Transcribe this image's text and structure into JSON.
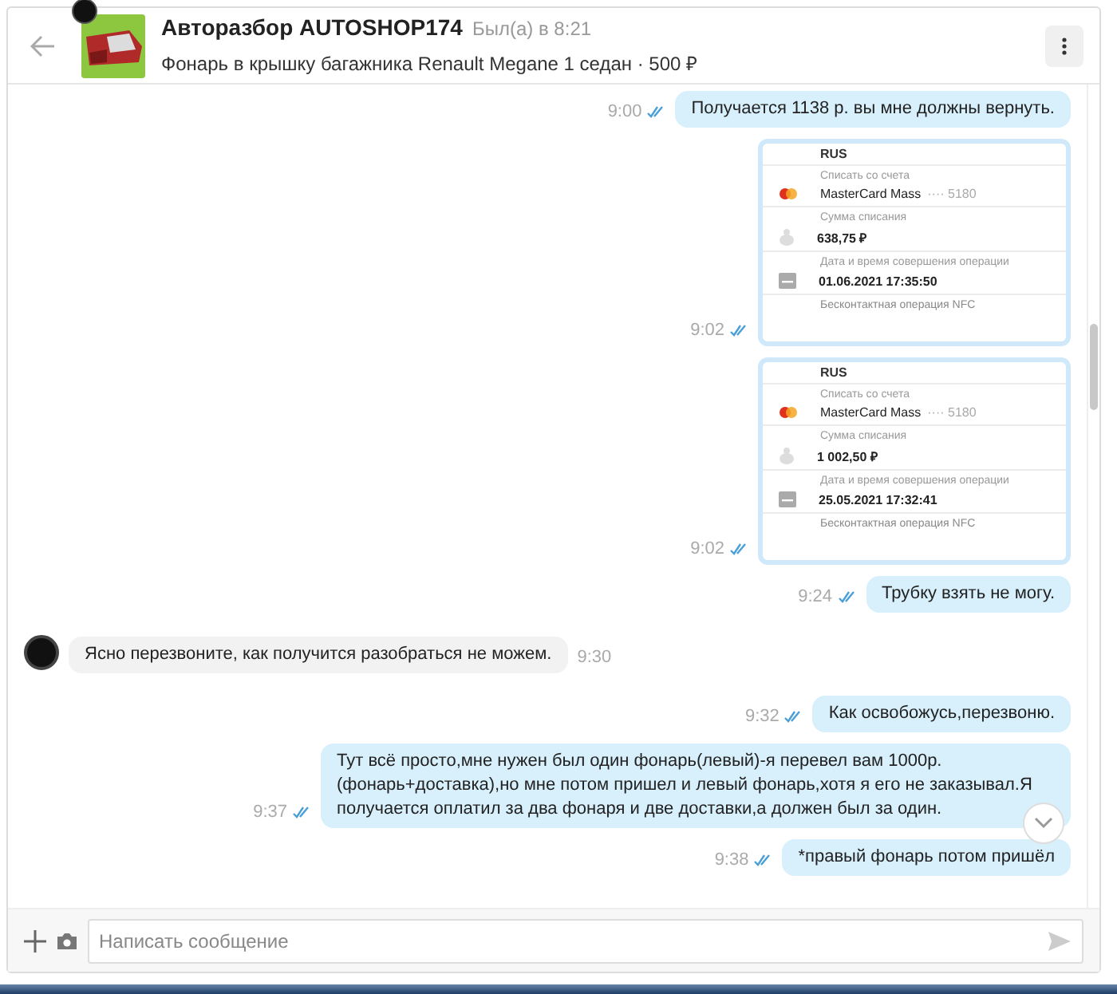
{
  "header": {
    "title": "Авторазбор AUTOSHOP174",
    "status": "Был(а) в 8:21",
    "subtitle": "Фонарь в крышку багажника Renault Megane 1 седан · 500 ₽"
  },
  "messages": [
    {
      "kind": "text",
      "outgoing": true,
      "time": "9:00",
      "read": true,
      "text": "Получается 1138 р. вы мне должны вернуть."
    },
    {
      "kind": "receipt",
      "outgoing": true,
      "time": "9:02",
      "read": true,
      "top": "RUS",
      "rows": [
        {
          "label": "Списать со счета",
          "value": "MasterCard Mass",
          "suffix": "···· 5180"
        },
        {
          "label": "Сумма списания",
          "value": "638,75 ₽"
        },
        {
          "label": "Дата и время совершения операции",
          "value": "01.06.2021 17:35:50"
        }
      ],
      "bottom": "Бесконтактная операция NFC"
    },
    {
      "kind": "receipt",
      "outgoing": true,
      "time": "9:02",
      "read": true,
      "top": "RUS",
      "rows": [
        {
          "label": "Списать со счета",
          "value": "MasterCard Mass",
          "suffix": "···· 5180"
        },
        {
          "label": "Сумма списания",
          "value": "1 002,50 ₽"
        },
        {
          "label": "Дата и время совершения операции",
          "value": "25.05.2021 17:32:41"
        }
      ],
      "bottom": "Бесконтактная операция NFC"
    },
    {
      "kind": "text",
      "outgoing": true,
      "time": "9:24",
      "read": true,
      "text": "Трубку взять не могу."
    },
    {
      "kind": "text",
      "outgoing": false,
      "time": "9:30",
      "text": "Ясно перезвоните, как получится разобраться не можем."
    },
    {
      "kind": "text",
      "outgoing": true,
      "time": "9:32",
      "read": true,
      "text": "Как освобожусь,перезвоню."
    },
    {
      "kind": "text",
      "outgoing": true,
      "time": "9:37",
      "read": true,
      "text": "Тут всё просто,мне нужен был один фонарь(левый)-я перевел вам 1000р.(фонарь+доставка),но мне потом пришел и левый фонарь,хотя я его не заказывал.Я получается оплатил за два фонаря и две доставки,а должен был за один."
    },
    {
      "kind": "text",
      "outgoing": true,
      "time": "9:38",
      "read": true,
      "text": "*правый фонарь потом пришёл"
    }
  ],
  "composer": {
    "placeholder": "Написать сообщение"
  }
}
